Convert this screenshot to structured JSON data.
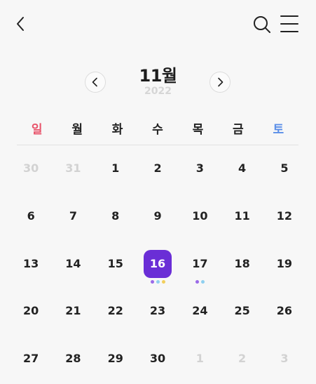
{
  "icons": {
    "back": "chevron-left-icon",
    "search": "search-icon",
    "menu": "hamburger-menu-icon",
    "prev": "chevron-left-icon",
    "next": "chevron-right-icon"
  },
  "header": {
    "month": "11월",
    "year": "2022"
  },
  "weekdays": [
    "일",
    "월",
    "화",
    "수",
    "목",
    "금",
    "토"
  ],
  "colors": {
    "accent": "#6a2ed6",
    "sunday": "#e8546b",
    "saturday": "#5b8fe8",
    "muted": "#d2d2d2"
  },
  "weeks": [
    [
      {
        "d": "30",
        "muted": true
      },
      {
        "d": "31",
        "muted": true
      },
      {
        "d": "1"
      },
      {
        "d": "2"
      },
      {
        "d": "3"
      },
      {
        "d": "4"
      },
      {
        "d": "5"
      }
    ],
    [
      {
        "d": "6"
      },
      {
        "d": "7"
      },
      {
        "d": "8"
      },
      {
        "d": "9"
      },
      {
        "d": "10"
      },
      {
        "d": "11"
      },
      {
        "d": "12"
      }
    ],
    [
      {
        "d": "13"
      },
      {
        "d": "14"
      },
      {
        "d": "15"
      },
      {
        "d": "16",
        "selected": true,
        "dots": [
          "#9a6ae8",
          "#8fd0f0",
          "#f2cf5c"
        ]
      },
      {
        "d": "17",
        "dots": [
          "#9a6ae8",
          "#8fd0f0"
        ]
      },
      {
        "d": "18"
      },
      {
        "d": "19"
      }
    ],
    [
      {
        "d": "20"
      },
      {
        "d": "21"
      },
      {
        "d": "22"
      },
      {
        "d": "23"
      },
      {
        "d": "24"
      },
      {
        "d": "25"
      },
      {
        "d": "26"
      }
    ],
    [
      {
        "d": "27"
      },
      {
        "d": "28"
      },
      {
        "d": "29"
      },
      {
        "d": "30"
      },
      {
        "d": "1",
        "muted": true
      },
      {
        "d": "2",
        "muted": true
      },
      {
        "d": "3",
        "muted": true
      }
    ]
  ]
}
